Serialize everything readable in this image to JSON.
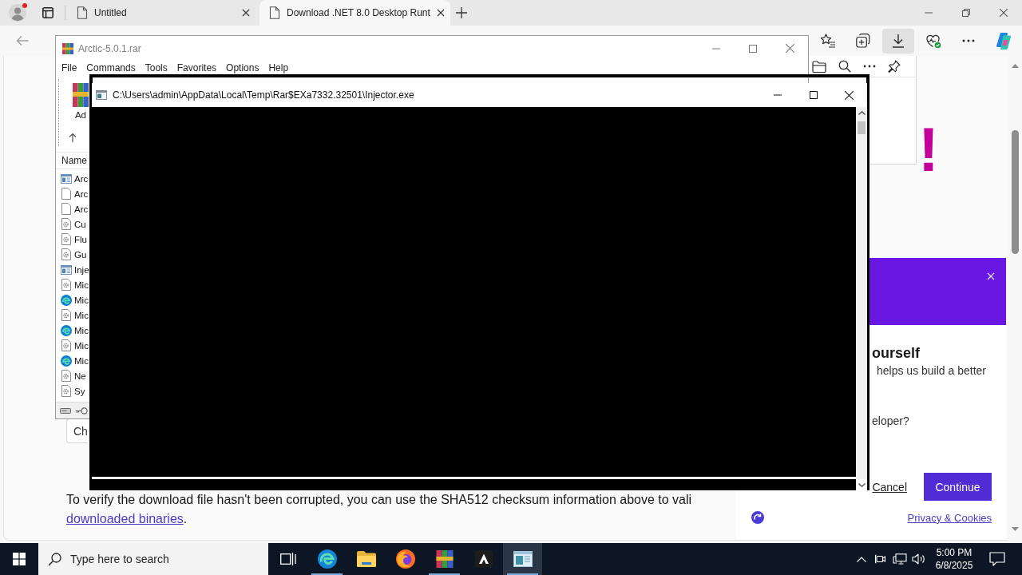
{
  "browser": {
    "tabs": [
      {
        "title": "Untitled",
        "selected": false
      },
      {
        "title": "Download .NET 8.0 Desktop Runt",
        "selected": true
      }
    ],
    "toolbar_buttons": [
      {
        "kind": "favorites",
        "selected": false
      },
      {
        "kind": "collections",
        "selected": false
      },
      {
        "kind": "downloads",
        "selected": true
      },
      {
        "kind": "essentials",
        "selected": false
      },
      {
        "kind": "more",
        "selected": false
      },
      {
        "kind": "copilot",
        "selected": false
      }
    ],
    "page": {
      "heading": "!",
      "button": "Ch",
      "paragraph": "To verify the download file hasn't been corrupted, you can use the SHA512 checksum information above to vali",
      "link": "downloaded binaries",
      "paragraph_end": "."
    },
    "survey": {
      "heading": "ourself",
      "lines": [
        "helps us build a better",
        "eloper?"
      ],
      "cancel": "Cancel",
      "continue": "Continue",
      "privacy": "Privacy & Cookies"
    }
  },
  "winrar": {
    "title": "Arctic-5.0.1.rar",
    "menu": [
      "File",
      "Commands",
      "Tools",
      "Favorites",
      "Options",
      "Help"
    ],
    "add_label": "Ad",
    "column": "Name",
    "files": [
      {
        "name": "Arc",
        "kind": "exe"
      },
      {
        "name": "Arc",
        "kind": "blank"
      },
      {
        "name": "Arc",
        "kind": "blank"
      },
      {
        "name": "Cu",
        "kind": "dll"
      },
      {
        "name": "Flu",
        "kind": "dll"
      },
      {
        "name": "Gu",
        "kind": "dll"
      },
      {
        "name": "Inje",
        "kind": "exe"
      },
      {
        "name": "Mic",
        "kind": "dll"
      },
      {
        "name": "Mic",
        "kind": "browser"
      },
      {
        "name": "Mic",
        "kind": "dll"
      },
      {
        "name": "Mic",
        "kind": "browser"
      },
      {
        "name": "Mic",
        "kind": "dll"
      },
      {
        "name": "Mic",
        "kind": "browser"
      },
      {
        "name": "Ne",
        "kind": "dll"
      },
      {
        "name": "Sy",
        "kind": "dll"
      }
    ]
  },
  "console": {
    "title": "C:\\Users\\admin\\AppData\\Local\\Temp\\Rar$EXa7332.32501\\Injector.exe"
  },
  "taskbar": {
    "search": {
      "placeholder": "Type here to search"
    },
    "apps": [
      {
        "kind": "task-view",
        "running": false,
        "selected": false
      },
      {
        "kind": "edge",
        "running": true,
        "selected": false
      },
      {
        "kind": "explorer",
        "running": false,
        "selected": false
      },
      {
        "kind": "firefox",
        "running": false,
        "selected": false
      },
      {
        "kind": "winrar",
        "running": true,
        "selected": false
      },
      {
        "kind": "triangle-app",
        "running": false,
        "selected": false
      },
      {
        "kind": "console",
        "running": true,
        "selected": true
      }
    ],
    "clock": {
      "time": "5:00 PM",
      "date": "6/8/2025"
    }
  }
}
